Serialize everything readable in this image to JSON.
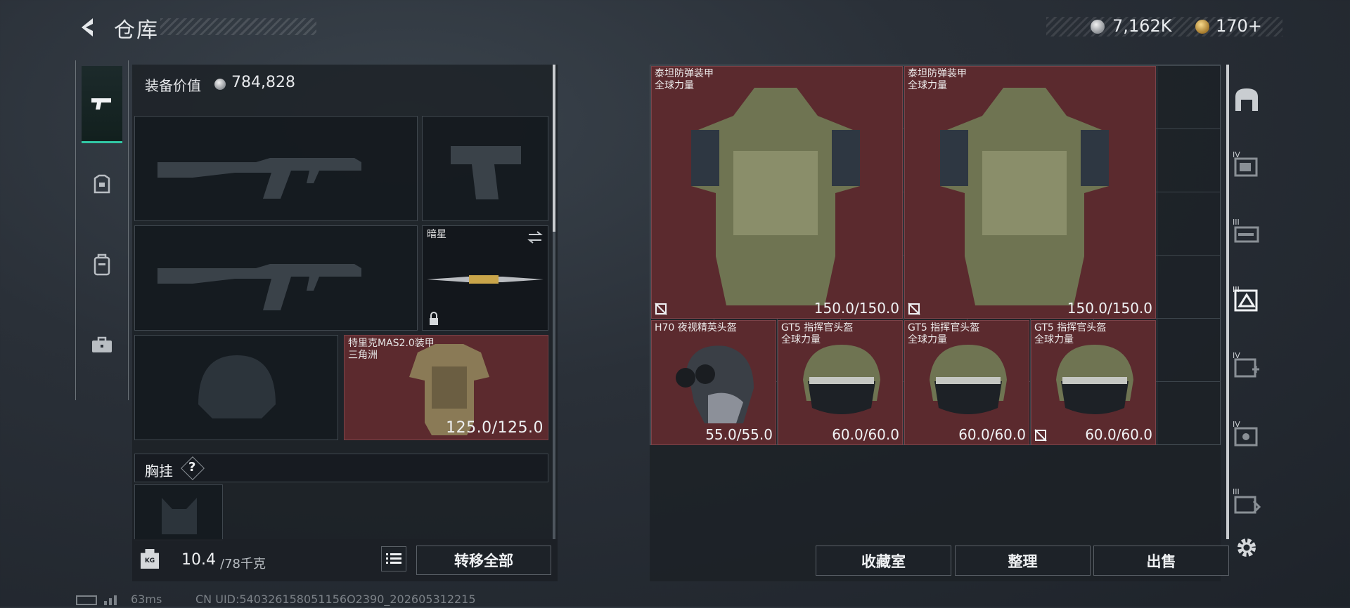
{
  "header": {
    "title": "仓库"
  },
  "currency": {
    "silver": "7,162K",
    "gold": "170+"
  },
  "equipment": {
    "value_label": "装备价值",
    "value": "784,828",
    "knife": {
      "name": "暗星"
    },
    "armor": {
      "name": "特里克MAS2.0装甲",
      "origin": "三角洲",
      "durability": "125.0/125.0"
    },
    "chest_rig": {
      "label": "胸挂",
      "help": "?"
    }
  },
  "weight": {
    "current": "10.4",
    "max": "/78千克",
    "icon_text": "KG"
  },
  "buttons": {
    "transfer_all": "转移全部",
    "collection": "收藏室",
    "organize": "整理",
    "sell": "出售"
  },
  "grid_items": [
    {
      "name": "泰坦防弹装甲",
      "sub": "全球力量",
      "durability": "150.0/150.0"
    },
    {
      "name": "泰坦防弹装甲",
      "sub": "全球力量",
      "durability": "150.0/150.0"
    },
    {
      "name": "H70 夜视精英头盔",
      "sub": "",
      "durability": "55.0/55.0"
    },
    {
      "name": "GT5 指挥官头盔",
      "sub": "全球力量",
      "durability": "60.0/60.0"
    },
    {
      "name": "GT5 指挥官头盔",
      "sub": "全球力量",
      "durability": "60.0/60.0"
    },
    {
      "name": "GT5 指挥官头盔",
      "sub": "全球力量",
      "durability": "60.0/60.0"
    }
  ],
  "right_tabs": [
    {
      "icon": "base-icon",
      "level": ""
    },
    {
      "icon": "container-icon",
      "level": "IV"
    },
    {
      "icon": "weapon-box-icon",
      "level": "III"
    },
    {
      "icon": "armor-box-icon",
      "level": "III"
    },
    {
      "icon": "medical-box-icon",
      "level": "IV"
    },
    {
      "icon": "supply-box-icon",
      "level": "IV"
    },
    {
      "icon": "gear-box-icon",
      "level": "III"
    }
  ],
  "status_bar": {
    "ping": "63ms",
    "uid": "CN UID:540326158051156O2390_202605312215"
  },
  "colors": {
    "accent": "#31c7a4",
    "item_bg": "#5b2a2e"
  }
}
